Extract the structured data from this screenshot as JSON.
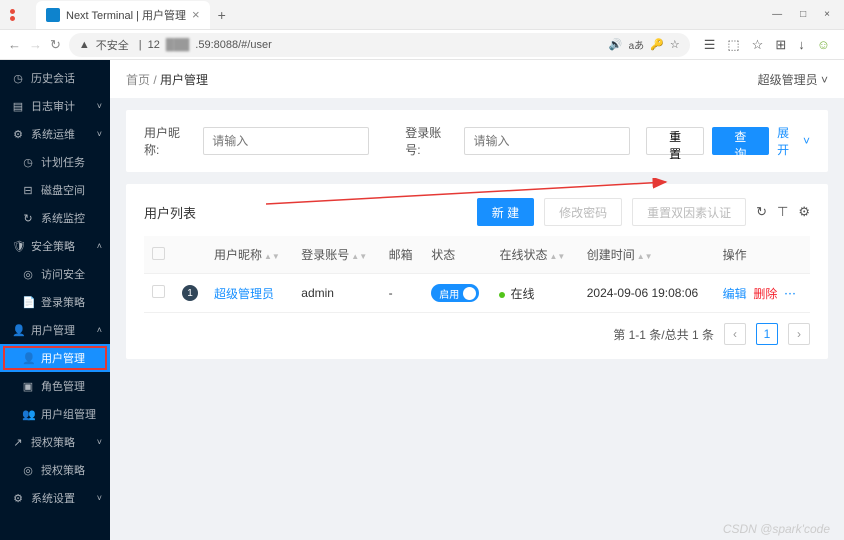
{
  "browser": {
    "tab_title": "Next Terminal | 用户管理",
    "tab_close": "×",
    "new_tab": "+",
    "win": {
      "min": "—",
      "max": "□",
      "close": "×"
    },
    "nav": {
      "back": "←",
      "fwd": "→",
      "reload": "↻"
    },
    "secure_label": "不安全",
    "url_prefix": "12",
    "url_suffix": ".59:8088/#/user",
    "icons": {
      "voice": "🔊",
      "trans": "aあ",
      "pwd": "🔑",
      "star": "☆",
      "profile": "☰",
      "ext": "⬚",
      "fav": "☆",
      "collect": "⊞",
      "dl": "↓",
      "face": "☺"
    }
  },
  "sidebar": [
    {
      "icon": "◷",
      "label": "历史会话"
    },
    {
      "icon": "▤",
      "label": "日志审计",
      "chev": "˅"
    },
    {
      "icon": "⚙",
      "label": "系统运维",
      "chev": "˅"
    },
    {
      "icon": "◷",
      "label": "计划任务",
      "child": true
    },
    {
      "icon": "⊟",
      "label": "磁盘空间",
      "child": true
    },
    {
      "icon": "↻",
      "label": "系统监控",
      "child": true
    },
    {
      "icon": "🛡",
      "label": "安全策略",
      "chev": "˄"
    },
    {
      "icon": "◎",
      "label": "访问安全",
      "child": true
    },
    {
      "icon": "📄",
      "label": "登录策略",
      "child": true
    },
    {
      "icon": "👤",
      "label": "用户管理",
      "chev": "˄"
    },
    {
      "icon": "👤",
      "label": "用户管理",
      "child": true,
      "active": true
    },
    {
      "icon": "▣",
      "label": "角色管理",
      "child": true
    },
    {
      "icon": "👥",
      "label": "用户组管理",
      "child": true
    },
    {
      "icon": "↗",
      "label": "授权策略",
      "chev": "˅"
    },
    {
      "icon": "◎",
      "label": "授权策略",
      "child": true
    },
    {
      "icon": "⚙",
      "label": "系统设置",
      "chev": "˅"
    }
  ],
  "crumbs": {
    "home": "首页",
    "sep": "/",
    "cur": "用户管理"
  },
  "admin_label": "超级管理员",
  "filters": {
    "nick_label": "用户昵称:",
    "acct_label": "登录账号:",
    "placeholder": "请输入",
    "reset": "重 置",
    "search": "查 询",
    "expand": "展开"
  },
  "list": {
    "title": "用户列表",
    "new": "新 建",
    "change_pw": "修改密码",
    "reset_2fa": "重置双因素认证",
    "reload_icon": "↻",
    "density_icon": "⊤",
    "settings_icon": "⚙"
  },
  "columns": {
    "nick": "用户昵称",
    "acct": "登录账号",
    "email": "邮箱",
    "status": "状态",
    "online": "在线状态",
    "created": "创建时间",
    "ops": "操作"
  },
  "rows": [
    {
      "idx": "1",
      "nick": "超级管理员",
      "acct": "admin",
      "email": "-",
      "status_text": "启用",
      "online": "在线",
      "created": "2024-09-06 19:08:06",
      "edit": "编辑",
      "del": "删除",
      "more": "⋯"
    }
  ],
  "pager": {
    "info": "第 1-1 条/总共 1 条",
    "page": "1"
  },
  "watermark": "CSDN @spark'code"
}
